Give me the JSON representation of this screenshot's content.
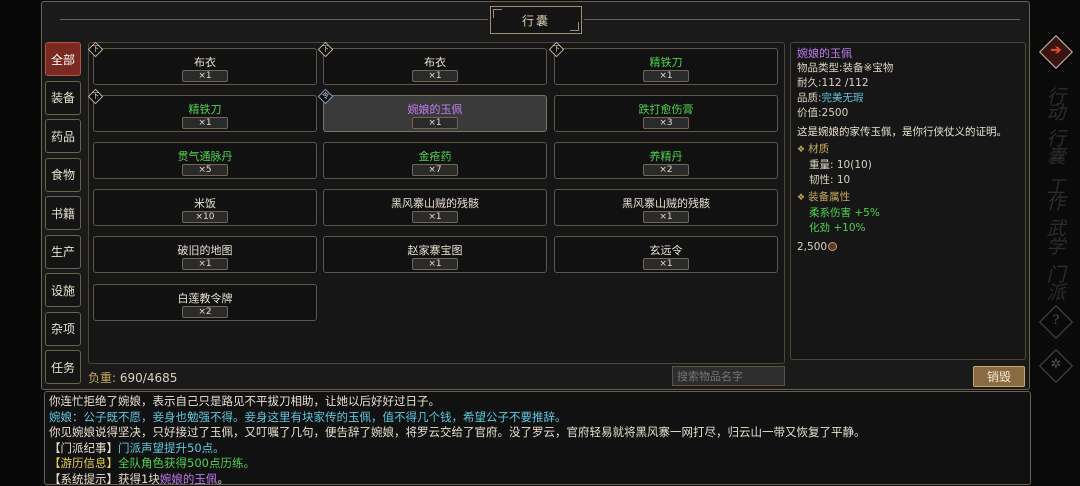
{
  "inventory": {
    "title": "行囊",
    "tabs": [
      "全部",
      "装备",
      "药品",
      "食物",
      "书籍",
      "生产",
      "设施",
      "杂项",
      "任务"
    ],
    "items": [
      {
        "name": "布衣",
        "qty": "×1",
        "color": "#e6e0d0",
        "badge": "下"
      },
      {
        "name": "布衣",
        "qty": "×1",
        "color": "#e6e0d0",
        "badge": "下"
      },
      {
        "name": "精铁刀",
        "qty": "×1",
        "color": "#4fd24f",
        "badge": "下"
      },
      {
        "name": "精铁刀",
        "qty": "×1",
        "color": "#4fd24f",
        "badge": "下"
      },
      {
        "name": "婉娘的玉佩",
        "qty": "×1",
        "color": "#c07cf0",
        "badge": "令"
      },
      {
        "name": "跌打愈伤膏",
        "qty": "×3",
        "color": "#4fd24f",
        "badge": ""
      },
      {
        "name": "贯气通脉丹",
        "qty": "×5",
        "color": "#4fd24f",
        "badge": ""
      },
      {
        "name": "金疮药",
        "qty": "×7",
        "color": "#4fd24f",
        "badge": ""
      },
      {
        "name": "养精丹",
        "qty": "×2",
        "color": "#4fd24f",
        "badge": ""
      },
      {
        "name": "米饭",
        "qty": "×10",
        "color": "#e6e0d0",
        "badge": ""
      },
      {
        "name": "黑风寨山贼的残骸",
        "qty": "×1",
        "color": "#e6e0d0",
        "badge": ""
      },
      {
        "name": "黑风寨山贼的残骸",
        "qty": "×1",
        "color": "#e6e0d0",
        "badge": ""
      },
      {
        "name": "破旧的地图",
        "qty": "×1",
        "color": "#e6e0d0",
        "badge": ""
      },
      {
        "name": "赵家寨宝图",
        "qty": "×1",
        "color": "#e6e0d0",
        "badge": ""
      },
      {
        "name": "玄远令",
        "qty": "×1",
        "color": "#e6e0d0",
        "badge": ""
      },
      {
        "name": "白莲教令牌",
        "qty": "×2",
        "color": "#e6e0d0",
        "badge": ""
      }
    ],
    "weight_label": "负重:",
    "weight_value": "690/4685",
    "search_placeholder": "搜索物品名字",
    "destroy_label": "销毁"
  },
  "detail": {
    "name": "婉娘的玉佩",
    "type_label": "物品类型:",
    "type_value": "装备※宝物",
    "durability_label": "耐久:",
    "durability_value": "112 /112",
    "quality_label": "品质:",
    "quality_value": "完美无瑕",
    "value_label": "价值:",
    "value_value": "2500",
    "description": "这是婉娘的家传玉佩，是你行侠仗义的证明。",
    "material_title": "材质",
    "weight_row": "重量: 10(10)",
    "toughness_row": "韧性: 10",
    "attr_title": "装备属性",
    "attr1": "柔系伤害 +5%",
    "attr2": "化劲 +10%",
    "price": "2,500"
  },
  "right_nav": {
    "glyphs": [
      "?"
    ],
    "vertical_texts": [
      "行",
      "动",
      "行",
      "囊",
      "工",
      "作",
      "武",
      "学",
      "门",
      "派"
    ]
  },
  "log": {
    "line1": "你连忙拒绝了婉娘，表示自己只是路见不平拔刀相助，让她以后好好过日子。",
    "line2": "婉娘：公子既不愿，妾身也勉强不得。妾身这里有块家传的玉佩，值不得几个钱，希望公子不要推辞。",
    "line3": "你见婉娘说得坚决，只好接过了玉佩，又叮嘱了几句，便告辞了婉娘，将罗云交给了官府。没了罗云，官府轻易就将黑风寨一网打尽，归云山一带又恢复了平静。",
    "line4_tag": "【门派纪事】",
    "line4_text": "门派声望提升50点。",
    "line5_tag": "【游历信息】",
    "line5_text": "全队角色获得500点历练。",
    "line6_tag": "【系统提示】",
    "line6_text": "获得1块",
    "line6_item": "婉娘的玉佩",
    "line6_end": "。"
  }
}
